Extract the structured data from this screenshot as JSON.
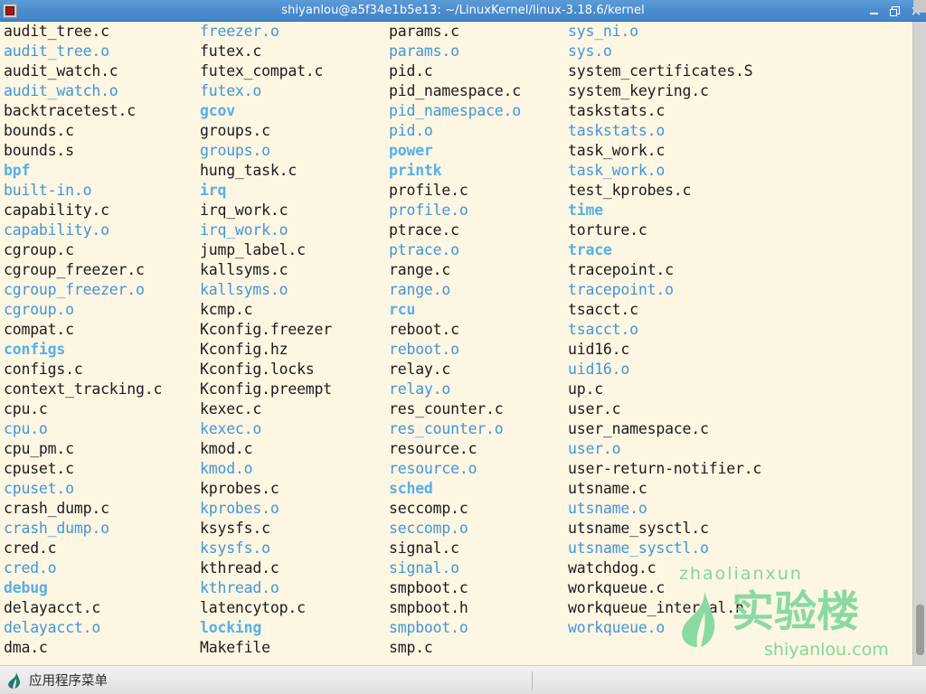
{
  "window": {
    "title": "shiyanlou@a5f34e1b5e13: ~/LinuxKernel/linux-3.18.6/kernel",
    "icon": "terminal-icon",
    "minimize_label": "",
    "maximize_label": "",
    "close_label": "×",
    "accent_color": "#4385c9",
    "background_color": "#fdf6e3"
  },
  "terminal": {
    "colors": {
      "file": "#1c1c1c",
      "object": "#4196d8",
      "directory": "#57b0e8"
    },
    "columns": [
      [
        {
          "name": "audit_tree.c",
          "kind": "file"
        },
        {
          "name": "audit_tree.o",
          "kind": "object"
        },
        {
          "name": "audit_watch.c",
          "kind": "file"
        },
        {
          "name": "audit_watch.o",
          "kind": "object"
        },
        {
          "name": "backtracetest.c",
          "kind": "file"
        },
        {
          "name": "bounds.c",
          "kind": "file"
        },
        {
          "name": "bounds.s",
          "kind": "file"
        },
        {
          "name": "bpf",
          "kind": "directory"
        },
        {
          "name": "built-in.o",
          "kind": "object"
        },
        {
          "name": "capability.c",
          "kind": "file"
        },
        {
          "name": "capability.o",
          "kind": "object"
        },
        {
          "name": "cgroup.c",
          "kind": "file"
        },
        {
          "name": "cgroup_freezer.c",
          "kind": "file"
        },
        {
          "name": "cgroup_freezer.o",
          "kind": "object"
        },
        {
          "name": "cgroup.o",
          "kind": "object"
        },
        {
          "name": "compat.c",
          "kind": "file"
        },
        {
          "name": "configs",
          "kind": "directory"
        },
        {
          "name": "configs.c",
          "kind": "file"
        },
        {
          "name": "context_tracking.c",
          "kind": "file"
        },
        {
          "name": "cpu.c",
          "kind": "file"
        },
        {
          "name": "cpu.o",
          "kind": "object"
        },
        {
          "name": "cpu_pm.c",
          "kind": "file"
        },
        {
          "name": "cpuset.c",
          "kind": "file"
        },
        {
          "name": "cpuset.o",
          "kind": "object"
        },
        {
          "name": "crash_dump.c",
          "kind": "file"
        },
        {
          "name": "crash_dump.o",
          "kind": "object"
        },
        {
          "name": "cred.c",
          "kind": "file"
        },
        {
          "name": "cred.o",
          "kind": "object"
        },
        {
          "name": "debug",
          "kind": "directory"
        },
        {
          "name": "delayacct.c",
          "kind": "file"
        },
        {
          "name": "delayacct.o",
          "kind": "object"
        },
        {
          "name": "dma.c",
          "kind": "file"
        }
      ],
      [
        {
          "name": "freezer.o",
          "kind": "object"
        },
        {
          "name": "futex.c",
          "kind": "file"
        },
        {
          "name": "futex_compat.c",
          "kind": "file"
        },
        {
          "name": "futex.o",
          "kind": "object"
        },
        {
          "name": "gcov",
          "kind": "directory"
        },
        {
          "name": "groups.c",
          "kind": "file"
        },
        {
          "name": "groups.o",
          "kind": "object"
        },
        {
          "name": "hung_task.c",
          "kind": "file"
        },
        {
          "name": "irq",
          "kind": "directory"
        },
        {
          "name": "irq_work.c",
          "kind": "file"
        },
        {
          "name": "irq_work.o",
          "kind": "object"
        },
        {
          "name": "jump_label.c",
          "kind": "file"
        },
        {
          "name": "kallsyms.c",
          "kind": "file"
        },
        {
          "name": "kallsyms.o",
          "kind": "object"
        },
        {
          "name": "kcmp.c",
          "kind": "file"
        },
        {
          "name": "Kconfig.freezer",
          "kind": "file"
        },
        {
          "name": "Kconfig.hz",
          "kind": "file"
        },
        {
          "name": "Kconfig.locks",
          "kind": "file"
        },
        {
          "name": "Kconfig.preempt",
          "kind": "file"
        },
        {
          "name": "kexec.c",
          "kind": "file"
        },
        {
          "name": "kexec.o",
          "kind": "object"
        },
        {
          "name": "kmod.c",
          "kind": "file"
        },
        {
          "name": "kmod.o",
          "kind": "object"
        },
        {
          "name": "kprobes.c",
          "kind": "file"
        },
        {
          "name": "kprobes.o",
          "kind": "object"
        },
        {
          "name": "ksysfs.c",
          "kind": "file"
        },
        {
          "name": "ksysfs.o",
          "kind": "object"
        },
        {
          "name": "kthread.c",
          "kind": "file"
        },
        {
          "name": "kthread.o",
          "kind": "object"
        },
        {
          "name": "latencytop.c",
          "kind": "file"
        },
        {
          "name": "locking",
          "kind": "directory"
        },
        {
          "name": "Makefile",
          "kind": "file"
        }
      ],
      [
        {
          "name": "params.c",
          "kind": "file"
        },
        {
          "name": "params.o",
          "kind": "object"
        },
        {
          "name": "pid.c",
          "kind": "file"
        },
        {
          "name": "pid_namespace.c",
          "kind": "file"
        },
        {
          "name": "pid_namespace.o",
          "kind": "object"
        },
        {
          "name": "pid.o",
          "kind": "object"
        },
        {
          "name": "power",
          "kind": "directory"
        },
        {
          "name": "printk",
          "kind": "directory"
        },
        {
          "name": "profile.c",
          "kind": "file"
        },
        {
          "name": "profile.o",
          "kind": "object"
        },
        {
          "name": "ptrace.c",
          "kind": "file"
        },
        {
          "name": "ptrace.o",
          "kind": "object"
        },
        {
          "name": "range.c",
          "kind": "file"
        },
        {
          "name": "range.o",
          "kind": "object"
        },
        {
          "name": "rcu",
          "kind": "directory"
        },
        {
          "name": "reboot.c",
          "kind": "file"
        },
        {
          "name": "reboot.o",
          "kind": "object"
        },
        {
          "name": "relay.c",
          "kind": "file"
        },
        {
          "name": "relay.o",
          "kind": "object"
        },
        {
          "name": "res_counter.c",
          "kind": "file"
        },
        {
          "name": "res_counter.o",
          "kind": "object"
        },
        {
          "name": "resource.c",
          "kind": "file"
        },
        {
          "name": "resource.o",
          "kind": "object"
        },
        {
          "name": "sched",
          "kind": "directory"
        },
        {
          "name": "seccomp.c",
          "kind": "file"
        },
        {
          "name": "seccomp.o",
          "kind": "object"
        },
        {
          "name": "signal.c",
          "kind": "file"
        },
        {
          "name": "signal.o",
          "kind": "object"
        },
        {
          "name": "smpboot.c",
          "kind": "file"
        },
        {
          "name": "smpboot.h",
          "kind": "file"
        },
        {
          "name": "smpboot.o",
          "kind": "object"
        },
        {
          "name": "smp.c",
          "kind": "file"
        }
      ],
      [
        {
          "name": "sys_ni.o",
          "kind": "object"
        },
        {
          "name": "sys.o",
          "kind": "object"
        },
        {
          "name": "system_certificates.S",
          "kind": "file"
        },
        {
          "name": "system_keyring.c",
          "kind": "file"
        },
        {
          "name": "taskstats.c",
          "kind": "file"
        },
        {
          "name": "taskstats.o",
          "kind": "object"
        },
        {
          "name": "task_work.c",
          "kind": "file"
        },
        {
          "name": "task_work.o",
          "kind": "object"
        },
        {
          "name": "test_kprobes.c",
          "kind": "file"
        },
        {
          "name": "time",
          "kind": "directory"
        },
        {
          "name": "torture.c",
          "kind": "file"
        },
        {
          "name": "trace",
          "kind": "directory"
        },
        {
          "name": "tracepoint.c",
          "kind": "file"
        },
        {
          "name": "tracepoint.o",
          "kind": "object"
        },
        {
          "name": "tsacct.c",
          "kind": "file"
        },
        {
          "name": "tsacct.o",
          "kind": "object"
        },
        {
          "name": "uid16.c",
          "kind": "file"
        },
        {
          "name": "uid16.o",
          "kind": "object"
        },
        {
          "name": "up.c",
          "kind": "file"
        },
        {
          "name": "user.c",
          "kind": "file"
        },
        {
          "name": "user_namespace.c",
          "kind": "file"
        },
        {
          "name": "user.o",
          "kind": "object"
        },
        {
          "name": "user-return-notifier.c",
          "kind": "file"
        },
        {
          "name": "utsname.c",
          "kind": "file"
        },
        {
          "name": "utsname.o",
          "kind": "object"
        },
        {
          "name": "utsname_sysctl.c",
          "kind": "file"
        },
        {
          "name": "utsname_sysctl.o",
          "kind": "object"
        },
        {
          "name": "watchdog.c",
          "kind": "file"
        },
        {
          "name": "workqueue.c",
          "kind": "file"
        },
        {
          "name": "workqueue_internal.h",
          "kind": "file"
        },
        {
          "name": "workqueue.o",
          "kind": "object"
        }
      ]
    ]
  },
  "watermark": {
    "top_text": "zhaolianxun",
    "brand_cn": "实验楼",
    "url": "shiyanlou.com",
    "color": "#8ad9a2"
  },
  "taskbar": {
    "app_menu_label": "应用程序菜单",
    "app_menu_icon": "leaf-icon",
    "icon_color": "#1d7a6c"
  }
}
